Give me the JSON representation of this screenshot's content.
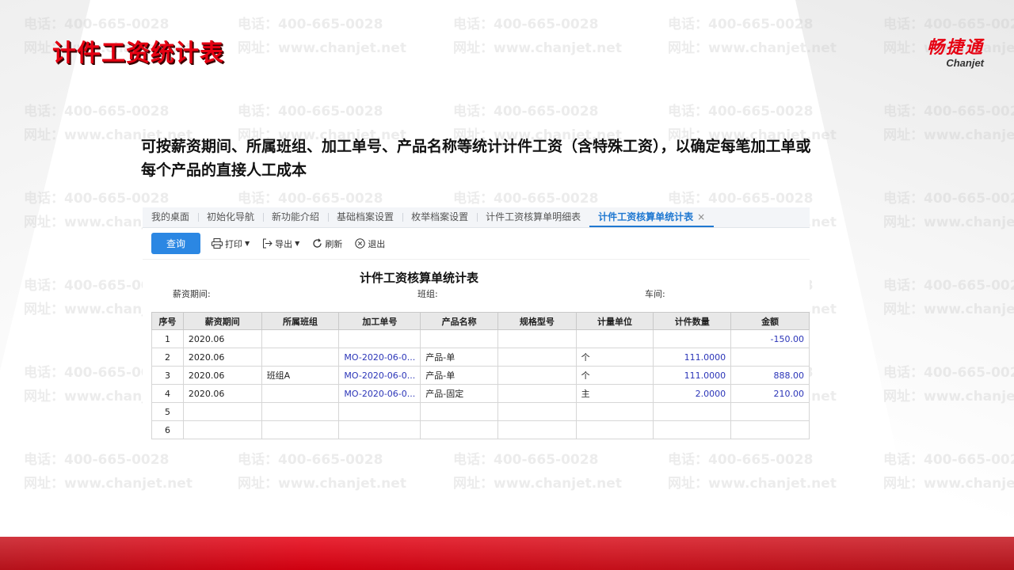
{
  "slide": {
    "title": "计件工资统计表",
    "description": "可按薪资期间、所属班组、加工单号、产品名称等统计计件工资（含特殊工资），以确定每笔加工单或每个产品的直接人工成本"
  },
  "logo": {
    "cn": "畅捷通",
    "en": "Chanjet"
  },
  "watermark": {
    "phone": "电话：400-665-0028",
    "site": "网址：www.chanjet.net"
  },
  "tabs": [
    {
      "label": "我的桌面"
    },
    {
      "label": "初始化导航"
    },
    {
      "label": "新功能介绍"
    },
    {
      "label": "基础档案设置"
    },
    {
      "label": "枚举档案设置"
    },
    {
      "label": "计件工资核算单明细表"
    },
    {
      "label": "计件工资核算单统计表",
      "active": true,
      "close": "×"
    }
  ],
  "toolbar": {
    "query": "查询",
    "print": "打印",
    "export": "导出",
    "refresh": "刷新",
    "exit": "退出"
  },
  "report": {
    "title": "计件工资核算单统计表",
    "filter_period": "薪资期间:",
    "filter_team": "班组:",
    "filter_workshop": "车间:"
  },
  "table": {
    "headers": [
      "序号",
      "薪资期间",
      "所属班组",
      "加工单号",
      "产品名称",
      "规格型号",
      "计量单位",
      "计件数量",
      "金额"
    ],
    "rows": [
      [
        "1",
        "2020.06",
        "",
        "",
        "",
        "",
        "",
        "",
        "-150.00"
      ],
      [
        "2",
        "2020.06",
        "",
        "MO-2020-06-0...",
        "产品-单",
        "",
        "个",
        "111.0000",
        ""
      ],
      [
        "3",
        "2020.06",
        "班组A",
        "MO-2020-06-0...",
        "产品-单",
        "",
        "个",
        "111.0000",
        "888.00"
      ],
      [
        "4",
        "2020.06",
        "",
        "MO-2020-06-0...",
        "产品-固定",
        "",
        "主",
        "2.0000",
        "210.00"
      ],
      [
        "5",
        "",
        "",
        "",
        "",
        "",
        "",
        "",
        ""
      ],
      [
        "6",
        "",
        "",
        "",
        "",
        "",
        "",
        "",
        ""
      ]
    ]
  },
  "colors": {
    "brand_red": "#e60012",
    "accent_blue": "#2b87e3",
    "link_blue": "#2b35b8"
  }
}
